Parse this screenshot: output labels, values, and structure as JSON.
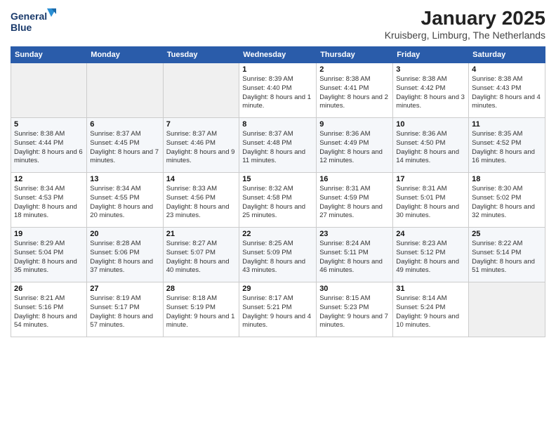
{
  "logo": {
    "line1": "General",
    "line2": "Blue"
  },
  "title": "January 2025",
  "location": "Kruisberg, Limburg, The Netherlands",
  "weekdays": [
    "Sunday",
    "Monday",
    "Tuesday",
    "Wednesday",
    "Thursday",
    "Friday",
    "Saturday"
  ],
  "weeks": [
    [
      {
        "day": "",
        "sunrise": "",
        "sunset": "",
        "daylight": ""
      },
      {
        "day": "",
        "sunrise": "",
        "sunset": "",
        "daylight": ""
      },
      {
        "day": "",
        "sunrise": "",
        "sunset": "",
        "daylight": ""
      },
      {
        "day": "1",
        "sunrise": "Sunrise: 8:39 AM",
        "sunset": "Sunset: 4:40 PM",
        "daylight": "Daylight: 8 hours and 1 minute."
      },
      {
        "day": "2",
        "sunrise": "Sunrise: 8:38 AM",
        "sunset": "Sunset: 4:41 PM",
        "daylight": "Daylight: 8 hours and 2 minutes."
      },
      {
        "day": "3",
        "sunrise": "Sunrise: 8:38 AM",
        "sunset": "Sunset: 4:42 PM",
        "daylight": "Daylight: 8 hours and 3 minutes."
      },
      {
        "day": "4",
        "sunrise": "Sunrise: 8:38 AM",
        "sunset": "Sunset: 4:43 PM",
        "daylight": "Daylight: 8 hours and 4 minutes."
      }
    ],
    [
      {
        "day": "5",
        "sunrise": "Sunrise: 8:38 AM",
        "sunset": "Sunset: 4:44 PM",
        "daylight": "Daylight: 8 hours and 6 minutes."
      },
      {
        "day": "6",
        "sunrise": "Sunrise: 8:37 AM",
        "sunset": "Sunset: 4:45 PM",
        "daylight": "Daylight: 8 hours and 7 minutes."
      },
      {
        "day": "7",
        "sunrise": "Sunrise: 8:37 AM",
        "sunset": "Sunset: 4:46 PM",
        "daylight": "Daylight: 8 hours and 9 minutes."
      },
      {
        "day": "8",
        "sunrise": "Sunrise: 8:37 AM",
        "sunset": "Sunset: 4:48 PM",
        "daylight": "Daylight: 8 hours and 11 minutes."
      },
      {
        "day": "9",
        "sunrise": "Sunrise: 8:36 AM",
        "sunset": "Sunset: 4:49 PM",
        "daylight": "Daylight: 8 hours and 12 minutes."
      },
      {
        "day": "10",
        "sunrise": "Sunrise: 8:36 AM",
        "sunset": "Sunset: 4:50 PM",
        "daylight": "Daylight: 8 hours and 14 minutes."
      },
      {
        "day": "11",
        "sunrise": "Sunrise: 8:35 AM",
        "sunset": "Sunset: 4:52 PM",
        "daylight": "Daylight: 8 hours and 16 minutes."
      }
    ],
    [
      {
        "day": "12",
        "sunrise": "Sunrise: 8:34 AM",
        "sunset": "Sunset: 4:53 PM",
        "daylight": "Daylight: 8 hours and 18 minutes."
      },
      {
        "day": "13",
        "sunrise": "Sunrise: 8:34 AM",
        "sunset": "Sunset: 4:55 PM",
        "daylight": "Daylight: 8 hours and 20 minutes."
      },
      {
        "day": "14",
        "sunrise": "Sunrise: 8:33 AM",
        "sunset": "Sunset: 4:56 PM",
        "daylight": "Daylight: 8 hours and 23 minutes."
      },
      {
        "day": "15",
        "sunrise": "Sunrise: 8:32 AM",
        "sunset": "Sunset: 4:58 PM",
        "daylight": "Daylight: 8 hours and 25 minutes."
      },
      {
        "day": "16",
        "sunrise": "Sunrise: 8:31 AM",
        "sunset": "Sunset: 4:59 PM",
        "daylight": "Daylight: 8 hours and 27 minutes."
      },
      {
        "day": "17",
        "sunrise": "Sunrise: 8:31 AM",
        "sunset": "Sunset: 5:01 PM",
        "daylight": "Daylight: 8 hours and 30 minutes."
      },
      {
        "day": "18",
        "sunrise": "Sunrise: 8:30 AM",
        "sunset": "Sunset: 5:02 PM",
        "daylight": "Daylight: 8 hours and 32 minutes."
      }
    ],
    [
      {
        "day": "19",
        "sunrise": "Sunrise: 8:29 AM",
        "sunset": "Sunset: 5:04 PM",
        "daylight": "Daylight: 8 hours and 35 minutes."
      },
      {
        "day": "20",
        "sunrise": "Sunrise: 8:28 AM",
        "sunset": "Sunset: 5:06 PM",
        "daylight": "Daylight: 8 hours and 37 minutes."
      },
      {
        "day": "21",
        "sunrise": "Sunrise: 8:27 AM",
        "sunset": "Sunset: 5:07 PM",
        "daylight": "Daylight: 8 hours and 40 minutes."
      },
      {
        "day": "22",
        "sunrise": "Sunrise: 8:25 AM",
        "sunset": "Sunset: 5:09 PM",
        "daylight": "Daylight: 8 hours and 43 minutes."
      },
      {
        "day": "23",
        "sunrise": "Sunrise: 8:24 AM",
        "sunset": "Sunset: 5:11 PM",
        "daylight": "Daylight: 8 hours and 46 minutes."
      },
      {
        "day": "24",
        "sunrise": "Sunrise: 8:23 AM",
        "sunset": "Sunset: 5:12 PM",
        "daylight": "Daylight: 8 hours and 49 minutes."
      },
      {
        "day": "25",
        "sunrise": "Sunrise: 8:22 AM",
        "sunset": "Sunset: 5:14 PM",
        "daylight": "Daylight: 8 hours and 51 minutes."
      }
    ],
    [
      {
        "day": "26",
        "sunrise": "Sunrise: 8:21 AM",
        "sunset": "Sunset: 5:16 PM",
        "daylight": "Daylight: 8 hours and 54 minutes."
      },
      {
        "day": "27",
        "sunrise": "Sunrise: 8:19 AM",
        "sunset": "Sunset: 5:17 PM",
        "daylight": "Daylight: 8 hours and 57 minutes."
      },
      {
        "day": "28",
        "sunrise": "Sunrise: 8:18 AM",
        "sunset": "Sunset: 5:19 PM",
        "daylight": "Daylight: 9 hours and 1 minute."
      },
      {
        "day": "29",
        "sunrise": "Sunrise: 8:17 AM",
        "sunset": "Sunset: 5:21 PM",
        "daylight": "Daylight: 9 hours and 4 minutes."
      },
      {
        "day": "30",
        "sunrise": "Sunrise: 8:15 AM",
        "sunset": "Sunset: 5:23 PM",
        "daylight": "Daylight: 9 hours and 7 minutes."
      },
      {
        "day": "31",
        "sunrise": "Sunrise: 8:14 AM",
        "sunset": "Sunset: 5:24 PM",
        "daylight": "Daylight: 9 hours and 10 minutes."
      },
      {
        "day": "",
        "sunrise": "",
        "sunset": "",
        "daylight": ""
      }
    ]
  ]
}
